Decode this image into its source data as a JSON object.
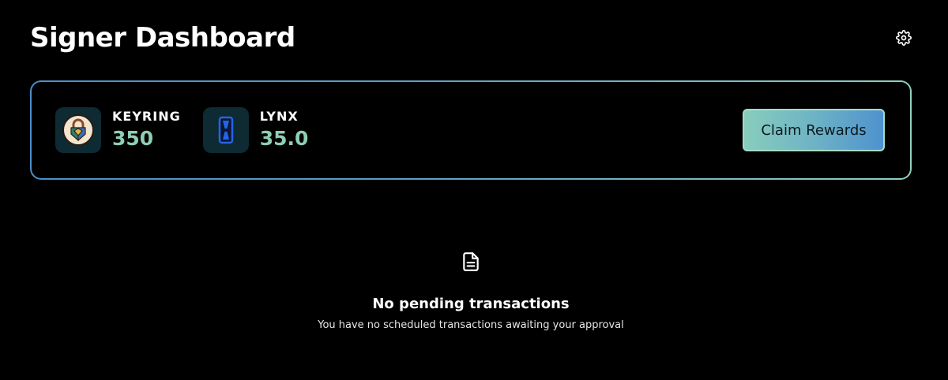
{
  "header": {
    "title": "Signer Dashboard",
    "settings_icon": "gear-icon"
  },
  "rewards": {
    "tokens": [
      {
        "name": "KEYRING",
        "amount": "350",
        "icon": "keyring-logo-icon"
      },
      {
        "name": "LYNX",
        "amount": "35.0",
        "icon": "lynx-logo-icon"
      }
    ],
    "claim_label": "Claim Rewards"
  },
  "empty_state": {
    "icon": "document-icon",
    "title": "No pending transactions",
    "subtitle": "You have no scheduled transactions awaiting your approval"
  },
  "colors": {
    "background": "#000000",
    "amount": "#8ecfb4",
    "card_border_start": "#4a8fc9",
    "card_border_end": "#8fcfc0",
    "button_start": "#88cdbd",
    "button_end": "#4f92cf"
  }
}
